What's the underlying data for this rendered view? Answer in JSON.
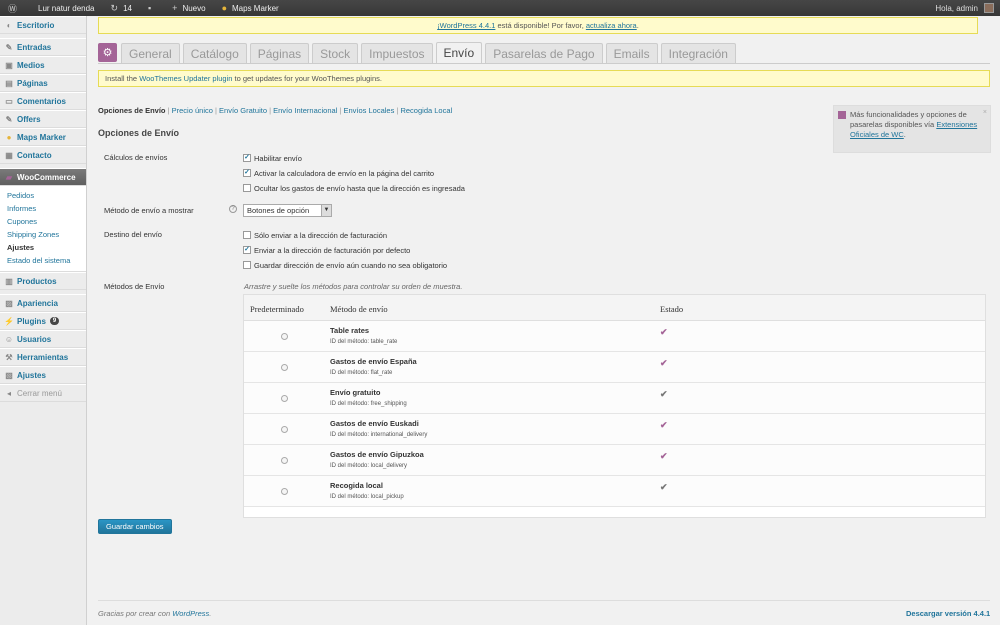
{
  "adminbar": {
    "site_name": "Lur natur denda",
    "updates_count": "14",
    "new_label": "Nuevo",
    "maps_marker": "Maps Marker",
    "greeting": "Hola, admin"
  },
  "sidebar": {
    "escritorio": "Escritorio",
    "entradas": "Entradas",
    "medios": "Medios",
    "paginas": "Páginas",
    "comentarios": "Comentarios",
    "offers": "Offers",
    "maps_marker": "Maps Marker",
    "contacto": "Contacto",
    "woocommerce": "WooCommerce",
    "sub": [
      "Pedidos",
      "Informes",
      "Cupones",
      "Shipping Zones",
      "Ajustes",
      "Estado del sistema"
    ],
    "productos": "Productos",
    "apariencia": "Apariencia",
    "plugins": "Plugins",
    "plugins_badge": "9",
    "usuarios": "Usuarios",
    "herramientas": "Herramientas",
    "ajustes": "Ajustes",
    "collapse": "Cerrar menú"
  },
  "update_nag": {
    "text": " está disponible! Por favor, ",
    "version_link": "¡WordPress 4.4.1",
    "action_link": "actualiza ahora",
    "end": "."
  },
  "tabs": [
    "General",
    "Catálogo",
    "Páginas",
    "Stock",
    "Impuestos",
    "Envío",
    "Pasarelas de Pago",
    "Emails",
    "Integración"
  ],
  "notice": {
    "prefix": "Install the ",
    "link": "WooThemes Updater plugin",
    "suffix": " to get updates for your WooThemes plugins."
  },
  "subsub": {
    "current": "Opciones de Envío",
    "links": [
      "Precio único",
      "Envío Gratuito",
      "Envío Internacional",
      "Envíos Locales",
      "Recogida Local"
    ]
  },
  "promo": {
    "text": "Más funcionalidades y opciones de pasarelas disponibles vía ",
    "link": "Extensiones Oficiales de WC",
    "end": "."
  },
  "section_title": "Opciones de Envío",
  "calculos": {
    "label": "Cálculos de envíos",
    "options": [
      {
        "label": "Habilitar envío",
        "checked": "✓"
      },
      {
        "label": "Activar la calculadora de envío en la página del carrito",
        "checked": "✓"
      },
      {
        "label": "Ocultar los gastos de envío hasta que la dirección es ingresada",
        "checked": ""
      }
    ]
  },
  "metodo_mostrar": {
    "label": "Método de envío a mostrar",
    "value": "Botones de opción"
  },
  "destino": {
    "label": "Destino del envío",
    "options": [
      {
        "label": "Sólo enviar a la dirección de facturación",
        "checked": ""
      },
      {
        "label": "Enviar a la dirección de facturación por defecto",
        "checked": "✓"
      },
      {
        "label": "Guardar dirección de envío aún cuando no sea obligatorio",
        "checked": ""
      }
    ]
  },
  "metodos": {
    "label": "Métodos de Envío",
    "hint": "Arrastre y suelte los métodos para controlar su orden de muestra.",
    "headers": [
      "Predeterminado",
      "Método de envío",
      "Estado"
    ],
    "rows": [
      {
        "name": "Table rates",
        "id": "ID del método: table_rate",
        "status_color": "#a46497"
      },
      {
        "name": "Gastos de envío España",
        "id": "ID del método: flat_rate",
        "status_color": "#a46497"
      },
      {
        "name": "Envío gratuito",
        "id": "ID del método: free_shipping",
        "status_color": "#777777"
      },
      {
        "name": "Gastos de envío Euskadi",
        "id": "ID del método: international_delivery",
        "status_color": "#a46497"
      },
      {
        "name": "Gastos de envío Gipuzkoa",
        "id": "ID del método: local_delivery",
        "status_color": "#a46497"
      },
      {
        "name": "Recogida local",
        "id": "ID del método: local_pickup",
        "status_color": "#777777"
      }
    ]
  },
  "save_label": "Guardar cambios",
  "footer": {
    "left_prefix": "Gracias por crear con ",
    "left_link": "WordPress",
    "left_end": ".",
    "right": "Descargar versión 4.4.1"
  }
}
